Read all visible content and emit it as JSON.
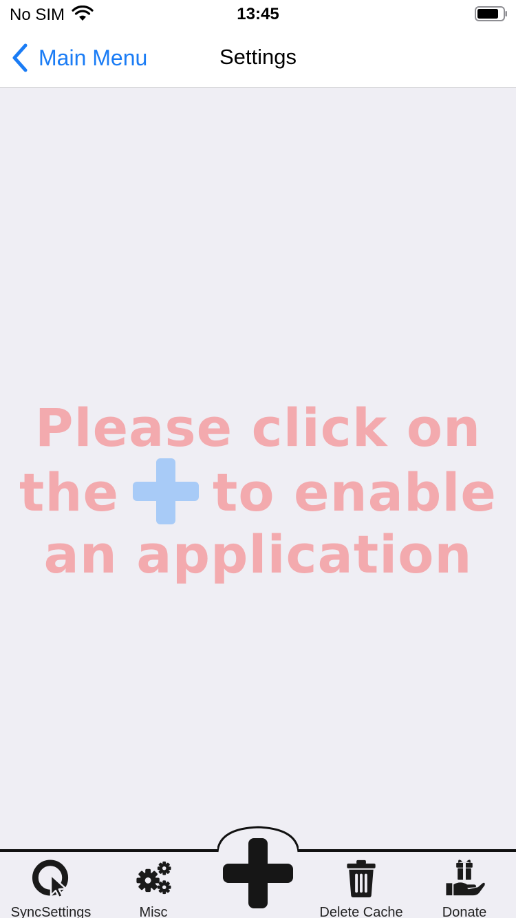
{
  "status_bar": {
    "carrier": "No SIM",
    "time": "13:45",
    "wifi_icon": "wifi-icon",
    "battery_icon": "battery-icon"
  },
  "nav": {
    "back_label": "Main Menu",
    "title": "Settings",
    "accent_color": "#1a7cf5"
  },
  "empty_state": {
    "line1": "Please click on",
    "line2_before": "the",
    "line2_after": "to enable",
    "line3": "an application",
    "inline_icon": "plus-icon",
    "text_color": "#f3aaae",
    "icon_color": "#a8cbf7"
  },
  "tabs": [
    {
      "label": "SyncSettings",
      "icon": "sync-settings-icon"
    },
    {
      "label": "Misc",
      "icon": "gears-icon"
    },
    {
      "label": "Delete Cache",
      "icon": "trash-icon"
    },
    {
      "label": "Donate",
      "icon": "donate-icon"
    }
  ],
  "center_action": {
    "icon": "plus-icon"
  }
}
